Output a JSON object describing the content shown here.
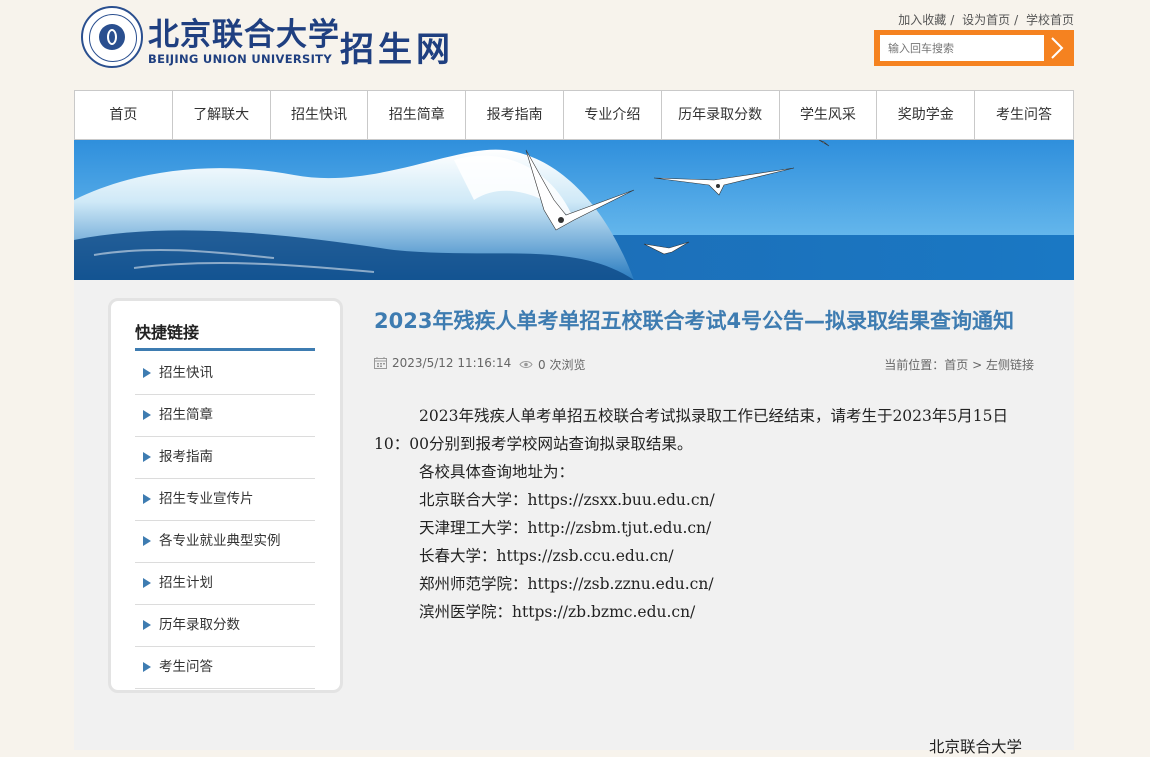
{
  "header": {
    "logo_cn": "北京联合大学",
    "logo_en": "BEIJING UNION UNIVERSITY",
    "site_name": "招生网",
    "top_links": [
      "加入收藏",
      "设为首页",
      "学校首页"
    ],
    "search_placeholder": "输入回车搜索"
  },
  "nav": {
    "items": [
      "首页",
      "了解联大",
      "招生快讯",
      "招生简章",
      "报考指南",
      "专业介绍",
      "历年录取分数",
      "学生风采",
      "奖助学金",
      "考生问答"
    ]
  },
  "sidebar": {
    "title": "快捷链接",
    "items": [
      "招生快讯",
      "招生简章",
      "报考指南",
      "招生专业宣传片",
      "各专业就业典型实例",
      "招生计划",
      "历年录取分数",
      "考生问答"
    ]
  },
  "article": {
    "title": "2023年残疾人单考单招五校联合考试4号公告—拟录取结果查询通知",
    "date": "2023/5/12 11:16:14",
    "views": "0 次浏览",
    "breadcrumb_label": "当前位置：",
    "breadcrumb": [
      "首页",
      "左侧链接"
    ],
    "paragraphs": [
      "2023年残疾人单考单招五校联合考试拟录取工作已经结束，请考生于2023年5月15日10：00分别到报考学校网站查询拟录取结果。",
      "各校具体查询地址为：",
      "北京联合大学：https://zsxx.buu.edu.cn/",
      "天津理工大学：http://zsbm.tjut.edu.cn/",
      "长春大学：https://zsb.ccu.edu.cn/",
      "郑州师范学院：https://zsb.zznu.edu.cn/",
      "滨州医学院：https://zb.bzmc.edu.cn/"
    ],
    "signature": "北京联合大学"
  },
  "colors": {
    "brand_blue": "#1f3f80",
    "title_blue": "#3e7cb1",
    "search_orange": "#f58220"
  }
}
